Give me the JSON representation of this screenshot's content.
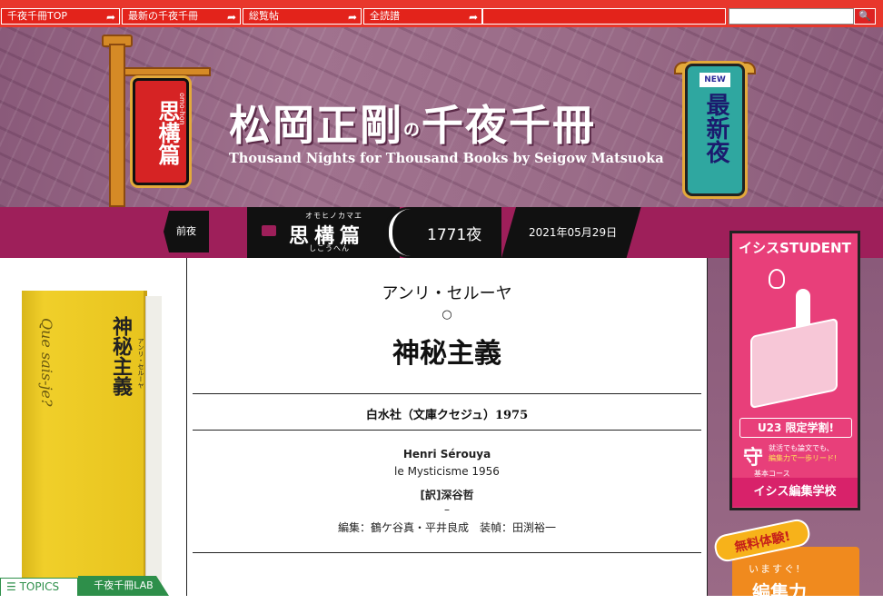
{
  "nav": {
    "items": [
      "千夜千冊TOP",
      "最新の千夜千冊",
      "総覧帖",
      "全読譜"
    ],
    "arrow": "➦",
    "search_placeholder": "",
    "search_icon": "🔍"
  },
  "banner": {
    "sign_text": "思構篇",
    "sign_small": "omo-hon",
    "title_main": "松岡正剛",
    "title_no": "の",
    "title_end": "千夜千冊",
    "subtitle_en": "Thousand Nights for Thousand Books by Seigow Matsuoka",
    "new_label": "NEW",
    "new_text": "最新夜"
  },
  "strip": {
    "prev": "前夜",
    "category_ruby_top": "オモヒノカマエ",
    "category": "思構篇",
    "category_ruby_bottom": "しこうへん",
    "night_number": "1771夜",
    "date": "2021年05月29日"
  },
  "book_cover": {
    "title": "神秘主義",
    "scribble": "Que sais-je?",
    "author": "アンリ・セルーヤ"
  },
  "article": {
    "author_jp": "アンリ・セルーヤ",
    "separator": "○",
    "title": "神秘主義",
    "publisher": "白水社（文庫クセジュ）1975",
    "author_en": "Henri Sérouya",
    "original_title": "le Mysticisme 1956",
    "translator": "[訳]深谷哲",
    "dash": "–",
    "editors": "編集：鶴ケ谷真・平井良成　装幀：田渕裕一"
  },
  "ads": {
    "isis_head": "イシスSTUDENT",
    "u23": "U23 限定学割!",
    "mark": "守",
    "small1": "就活でも論文でも、",
    "small2": "編集力で一歩リード!",
    "course": "基本コース",
    "footer": "イシス編集学校",
    "badge": "無料体験!",
    "line2": "いますぐ!",
    "big": "編集力"
  },
  "bottom_tabs": {
    "topics": "TOPICS",
    "lab": "千夜千冊LAB"
  },
  "colors": {
    "nav_red": "#e3231b",
    "strip_magenta": "#9e1f5a",
    "accent_green": "#2e8f4a"
  }
}
